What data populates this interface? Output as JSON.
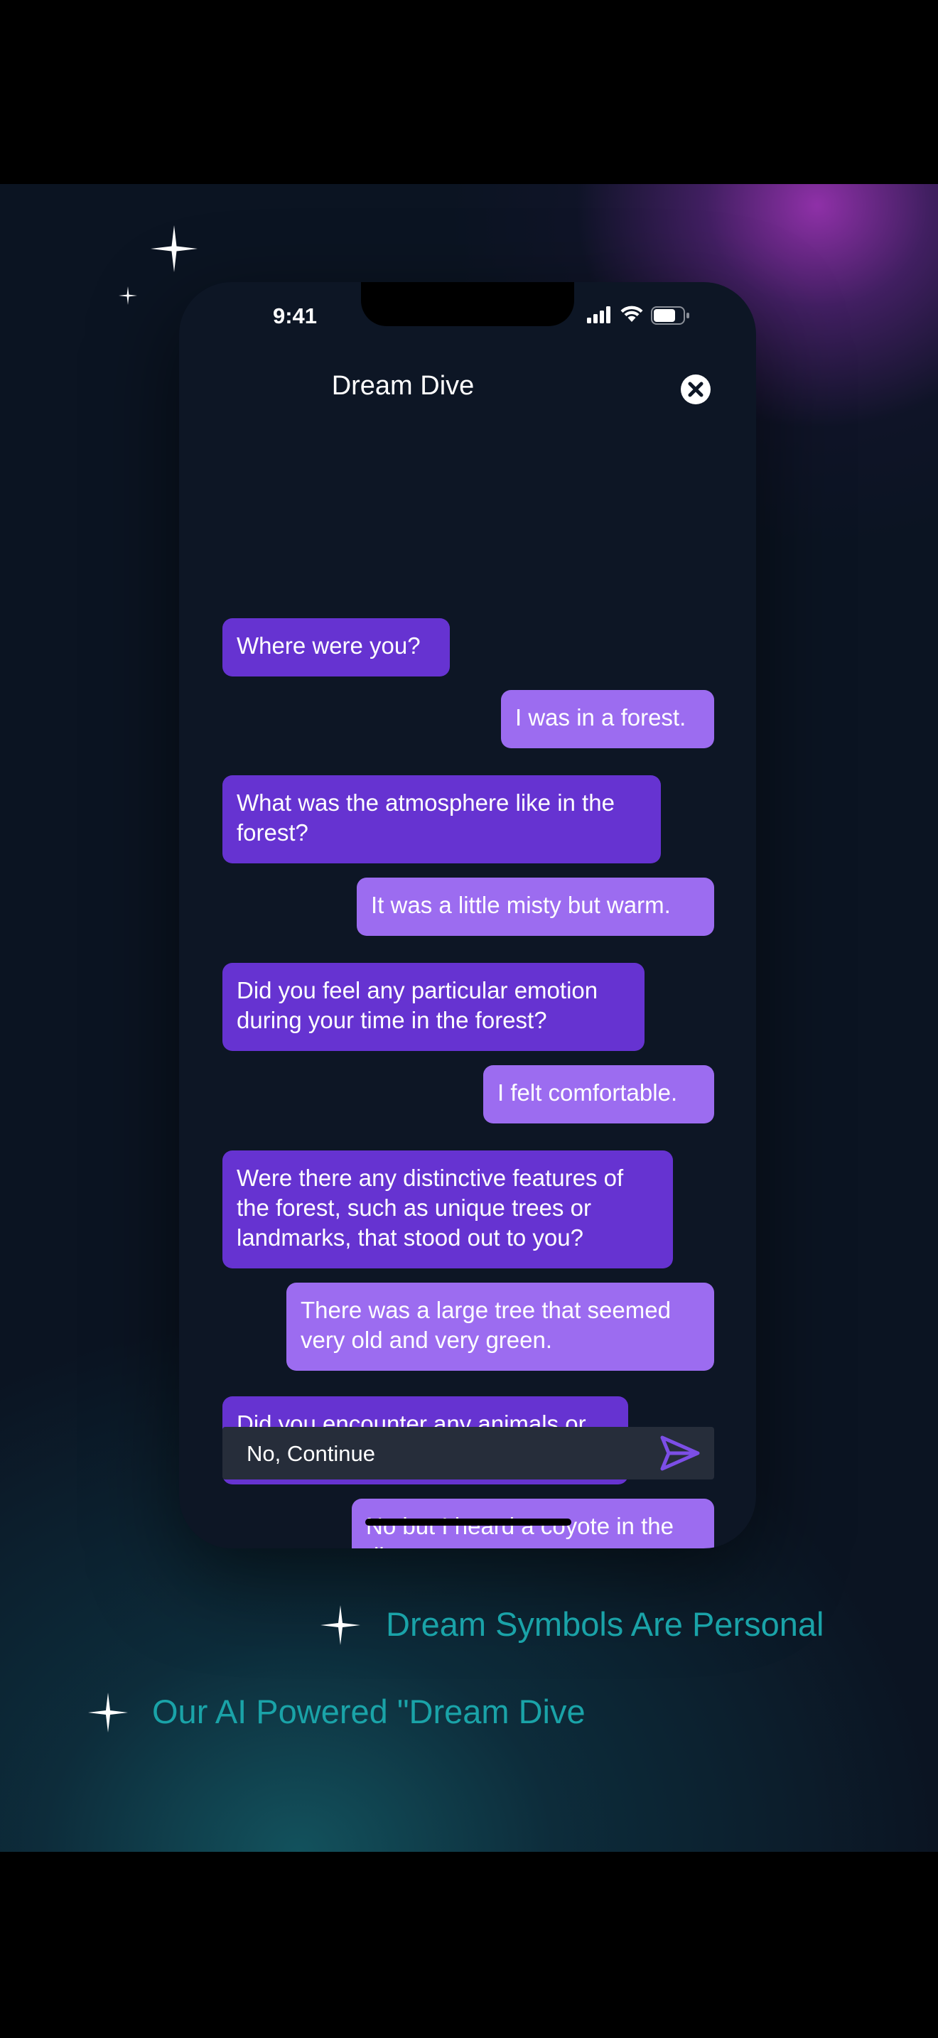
{
  "colors": {
    "ai_bubble": "#6633d1",
    "user_bubble": "#9c6cf0",
    "caption": "#1aa3a8",
    "background": "#0b1422",
    "send_icon": "#7c4ee6"
  },
  "status_bar": {
    "time": "9:41",
    "icons": [
      "signal-icon",
      "wifi-icon",
      "battery-icon"
    ]
  },
  "header": {
    "title": "Dream Dive",
    "close_icon": "close-icon"
  },
  "messages": [
    {
      "sender": "ai",
      "text": "Where were you?"
    },
    {
      "sender": "user",
      "text": "I was in a forest."
    },
    {
      "sender": "ai",
      "text": "What was the atmosphere like in the forest?"
    },
    {
      "sender": "user",
      "text": "It was a little misty but warm."
    },
    {
      "sender": "ai",
      "text": "Did you feel any particular emotion during your time in the forest?"
    },
    {
      "sender": "user",
      "text": "I felt comfortable."
    },
    {
      "sender": "ai",
      "text": "Were there any distinctive features of the forest, such as unique trees or landmarks, that stood out to you?"
    },
    {
      "sender": "user",
      "text": "There was a large tree that seemed very old and very green."
    },
    {
      "sender": "ai",
      "text": "Did you encounter any animals or wildlife in the forest?"
    },
    {
      "sender": "user",
      "text": "No but I heard a coyote in the distance"
    }
  ],
  "input": {
    "value": "No, Continue",
    "send_icon": "send-icon"
  },
  "captions": [
    "Dream Symbols Are Personal",
    "Our AI Powered \"Dream Dive"
  ]
}
